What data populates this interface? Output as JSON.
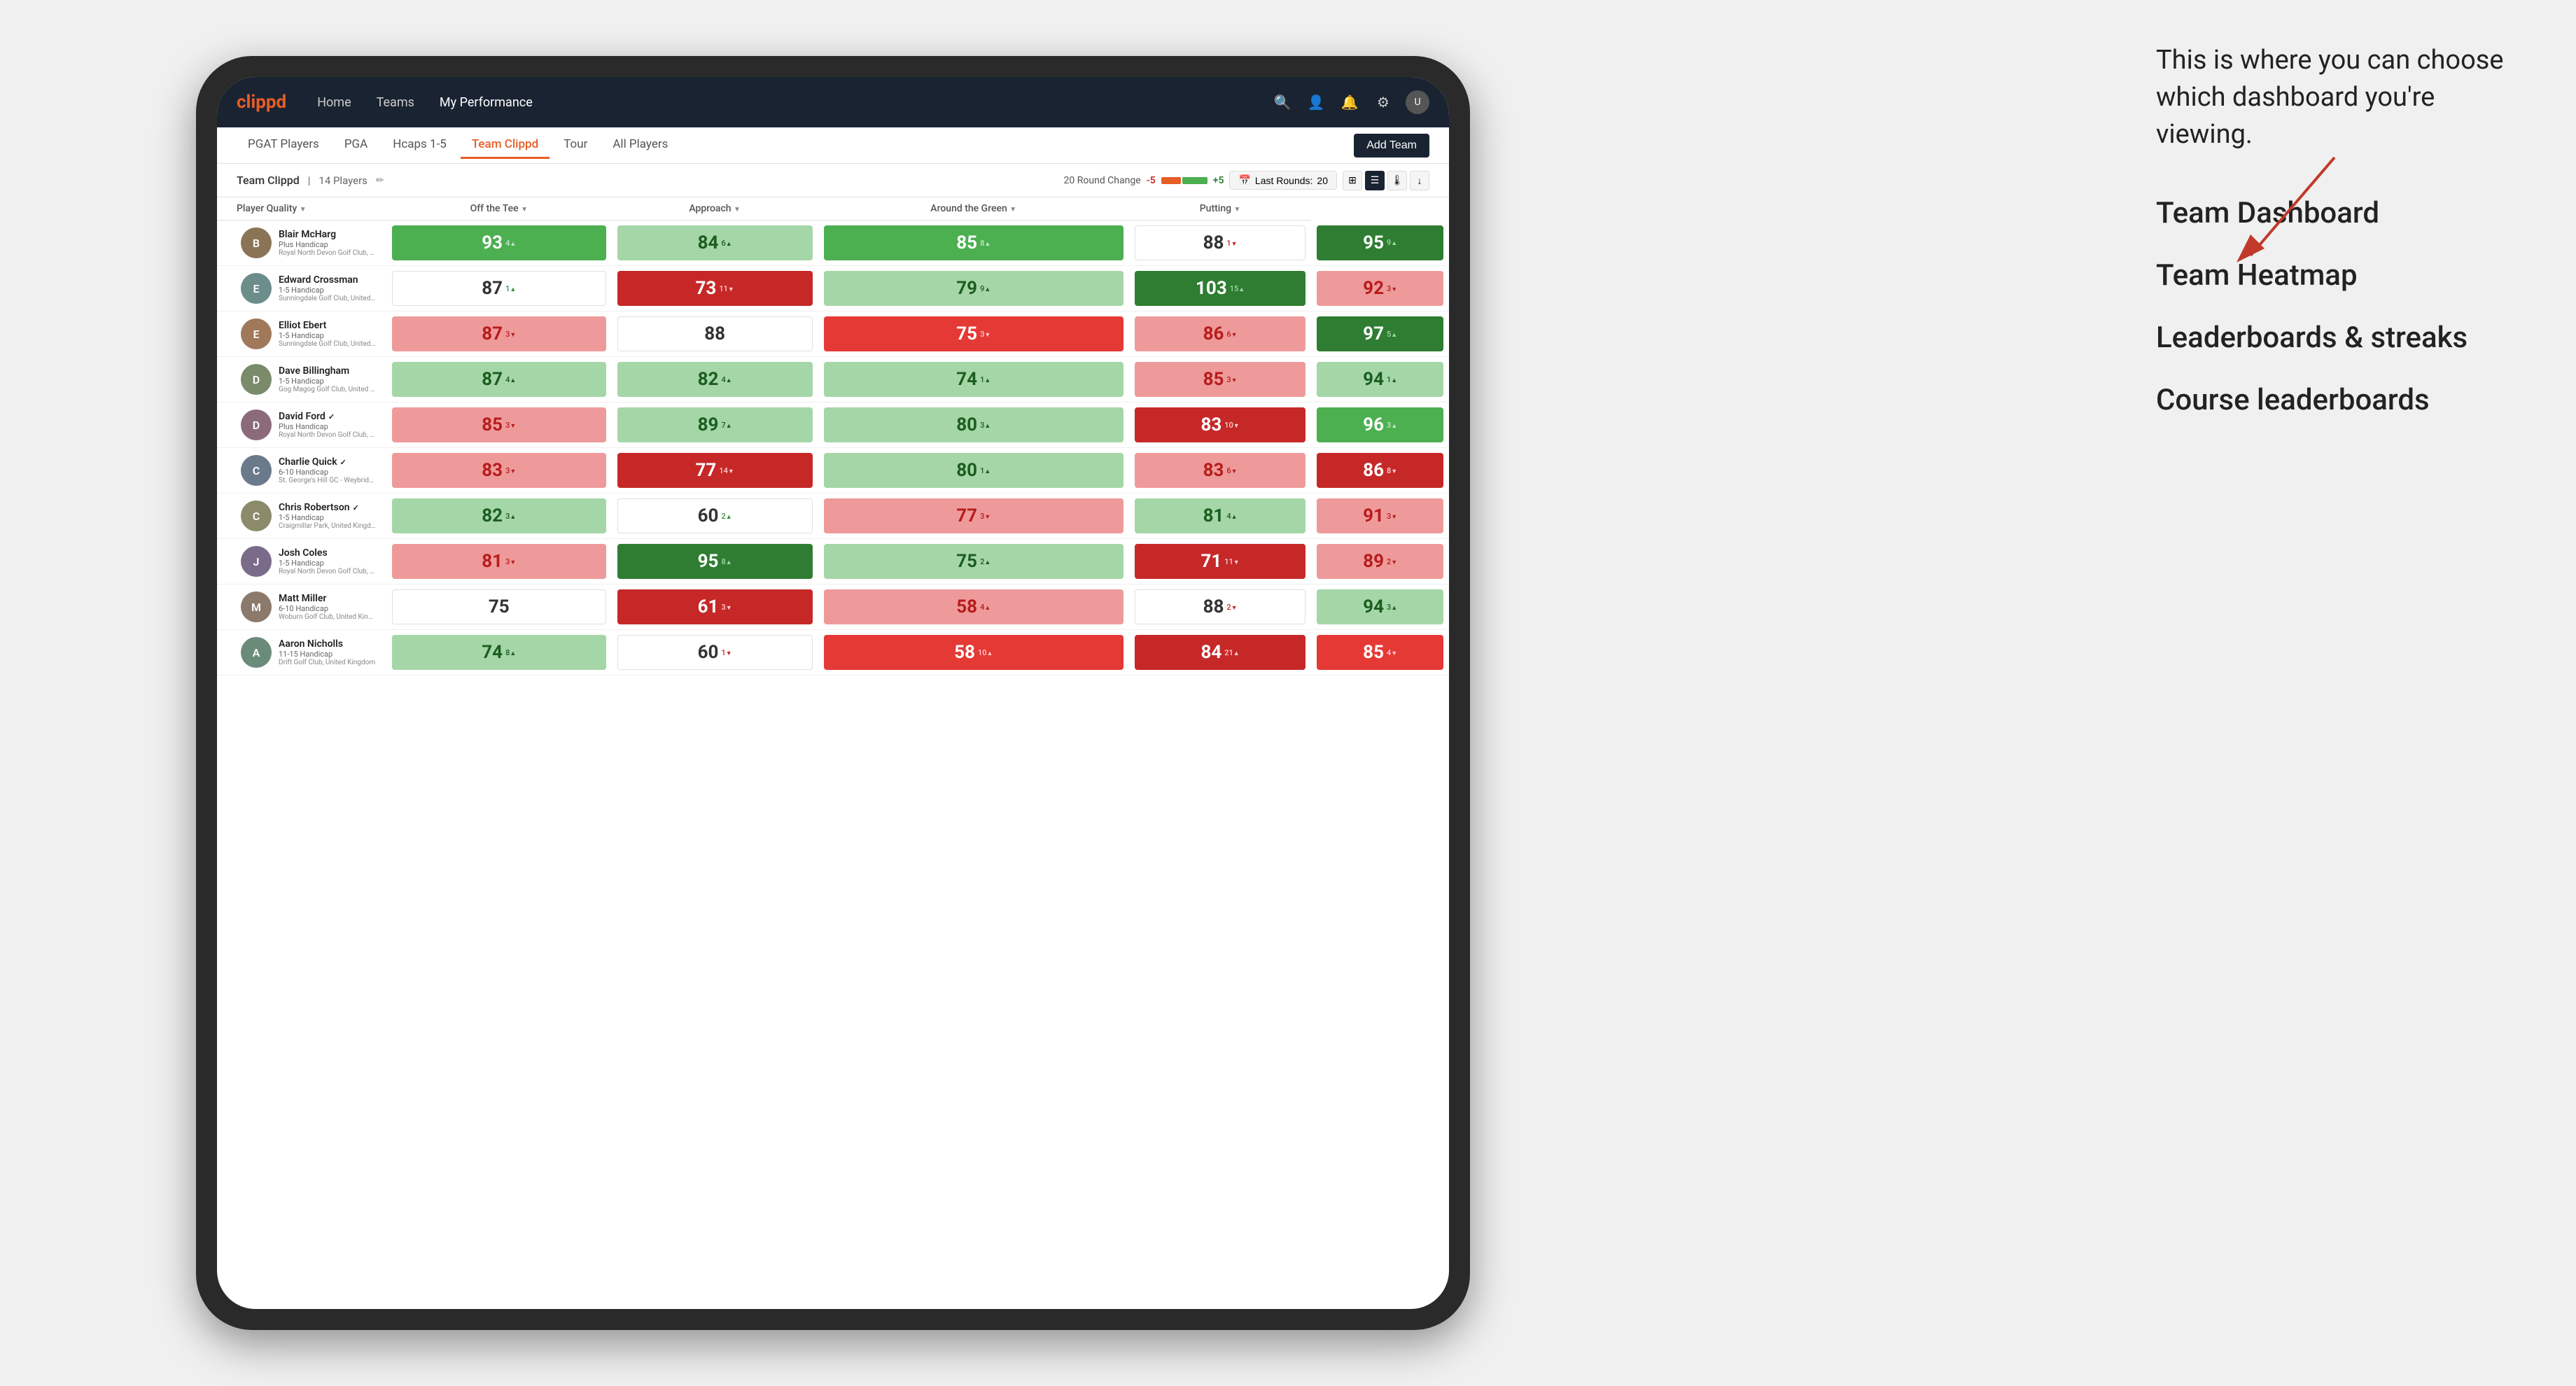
{
  "annotation": {
    "description": "This is where you can choose which dashboard you're viewing.",
    "menu_items": [
      "Team Dashboard",
      "Team Heatmap",
      "Leaderboards & streaks",
      "Course leaderboards"
    ]
  },
  "nav": {
    "logo": "clippd",
    "links": [
      "Home",
      "Teams",
      "My Performance"
    ],
    "active_link": "My Performance"
  },
  "sub_nav": {
    "links": [
      "PGAT Players",
      "PGA",
      "Hcaps 1-5",
      "Team Clippd",
      "Tour",
      "All Players"
    ],
    "active": "Team Clippd",
    "add_team": "Add Team"
  },
  "team_bar": {
    "team_name": "Team Clippd",
    "separator": "|",
    "player_count": "14 Players",
    "round_change_label": "20 Round Change",
    "round_change_neg": "-5",
    "round_change_pos": "+5",
    "last_rounds_label": "Last Rounds:",
    "last_rounds_value": "20"
  },
  "table": {
    "headers": [
      {
        "label": "Player Quality",
        "sort": true
      },
      {
        "label": "Off the Tee",
        "sort": true
      },
      {
        "label": "Approach",
        "sort": true
      },
      {
        "label": "Around the Green",
        "sort": true
      },
      {
        "label": "Putting",
        "sort": true
      }
    ],
    "players": [
      {
        "name": "Blair McHarg",
        "handicap": "Plus Handicap",
        "club": "Royal North Devon Golf Club, United Kingdom",
        "verified": false,
        "scores": [
          {
            "value": "93",
            "change": "4",
            "dir": "up",
            "color": "green-med"
          },
          {
            "value": "84",
            "change": "6",
            "dir": "up",
            "color": "green-light"
          },
          {
            "value": "85",
            "change": "8",
            "dir": "up",
            "color": "green-med"
          },
          {
            "value": "88",
            "change": "1",
            "dir": "down",
            "color": "white"
          },
          {
            "value": "95",
            "change": "9",
            "dir": "up",
            "color": "green-dark"
          }
        ]
      },
      {
        "name": "Edward Crossman",
        "handicap": "1-5 Handicap",
        "club": "Sunningdale Golf Club, United Kingdom",
        "verified": false,
        "scores": [
          {
            "value": "87",
            "change": "1",
            "dir": "up",
            "color": "white"
          },
          {
            "value": "73",
            "change": "11",
            "dir": "down",
            "color": "red-dark"
          },
          {
            "value": "79",
            "change": "9",
            "dir": "up",
            "color": "green-light"
          },
          {
            "value": "103",
            "change": "15",
            "dir": "up",
            "color": "green-dark"
          },
          {
            "value": "92",
            "change": "3",
            "dir": "down",
            "color": "red-light"
          }
        ]
      },
      {
        "name": "Elliot Ebert",
        "handicap": "1-5 Handicap",
        "club": "Sunningdale Golf Club, United Kingdom",
        "verified": false,
        "scores": [
          {
            "value": "87",
            "change": "3",
            "dir": "down",
            "color": "red-light"
          },
          {
            "value": "88",
            "change": "",
            "dir": "",
            "color": "white"
          },
          {
            "value": "75",
            "change": "3",
            "dir": "down",
            "color": "red-med"
          },
          {
            "value": "86",
            "change": "6",
            "dir": "down",
            "color": "red-light"
          },
          {
            "value": "97",
            "change": "5",
            "dir": "up",
            "color": "green-dark"
          }
        ]
      },
      {
        "name": "Dave Billingham",
        "handicap": "1-5 Handicap",
        "club": "Gog Magog Golf Club, United Kingdom",
        "verified": false,
        "scores": [
          {
            "value": "87",
            "change": "4",
            "dir": "up",
            "color": "green-light"
          },
          {
            "value": "82",
            "change": "4",
            "dir": "up",
            "color": "green-light"
          },
          {
            "value": "74",
            "change": "1",
            "dir": "up",
            "color": "green-light"
          },
          {
            "value": "85",
            "change": "3",
            "dir": "down",
            "color": "red-light"
          },
          {
            "value": "94",
            "change": "1",
            "dir": "up",
            "color": "green-light"
          }
        ]
      },
      {
        "name": "David Ford",
        "handicap": "Plus Handicap",
        "club": "Royal North Devon Golf Club, United Kingdom",
        "verified": true,
        "scores": [
          {
            "value": "85",
            "change": "3",
            "dir": "down",
            "color": "red-light"
          },
          {
            "value": "89",
            "change": "7",
            "dir": "up",
            "color": "green-light"
          },
          {
            "value": "80",
            "change": "3",
            "dir": "up",
            "color": "green-light"
          },
          {
            "value": "83",
            "change": "10",
            "dir": "down",
            "color": "red-dark"
          },
          {
            "value": "96",
            "change": "3",
            "dir": "up",
            "color": "green-med"
          }
        ]
      },
      {
        "name": "Charlie Quick",
        "handicap": "6-10 Handicap",
        "club": "St. George's Hill GC - Weybridge - Surrey, Uni...",
        "verified": true,
        "scores": [
          {
            "value": "83",
            "change": "3",
            "dir": "down",
            "color": "red-light"
          },
          {
            "value": "77",
            "change": "14",
            "dir": "down",
            "color": "red-dark"
          },
          {
            "value": "80",
            "change": "1",
            "dir": "up",
            "color": "green-light"
          },
          {
            "value": "83",
            "change": "6",
            "dir": "down",
            "color": "red-light"
          },
          {
            "value": "86",
            "change": "8",
            "dir": "down",
            "color": "red-dark"
          }
        ]
      },
      {
        "name": "Chris Robertson",
        "handicap": "1-5 Handicap",
        "club": "Craigmillar Park, United Kingdom",
        "verified": true,
        "scores": [
          {
            "value": "82",
            "change": "3",
            "dir": "up",
            "color": "green-light"
          },
          {
            "value": "60",
            "change": "2",
            "dir": "up",
            "color": "white"
          },
          {
            "value": "77",
            "change": "3",
            "dir": "down",
            "color": "red-light"
          },
          {
            "value": "81",
            "change": "4",
            "dir": "up",
            "color": "green-light"
          },
          {
            "value": "91",
            "change": "3",
            "dir": "down",
            "color": "red-light"
          }
        ]
      },
      {
        "name": "Josh Coles",
        "handicap": "1-5 Handicap",
        "club": "Royal North Devon Golf Club, United Kingdom",
        "verified": false,
        "scores": [
          {
            "value": "81",
            "change": "3",
            "dir": "down",
            "color": "red-light"
          },
          {
            "value": "95",
            "change": "8",
            "dir": "up",
            "color": "green-dark"
          },
          {
            "value": "75",
            "change": "2",
            "dir": "up",
            "color": "green-light"
          },
          {
            "value": "71",
            "change": "11",
            "dir": "down",
            "color": "red-dark"
          },
          {
            "value": "89",
            "change": "2",
            "dir": "down",
            "color": "red-light"
          }
        ]
      },
      {
        "name": "Matt Miller",
        "handicap": "6-10 Handicap",
        "club": "Woburn Golf Club, United Kingdom",
        "verified": false,
        "scores": [
          {
            "value": "75",
            "change": "",
            "dir": "",
            "color": "white"
          },
          {
            "value": "61",
            "change": "3",
            "dir": "down",
            "color": "red-dark"
          },
          {
            "value": "58",
            "change": "4",
            "dir": "up",
            "color": "red-light"
          },
          {
            "value": "88",
            "change": "2",
            "dir": "down",
            "color": "white"
          },
          {
            "value": "94",
            "change": "3",
            "dir": "up",
            "color": "green-light"
          }
        ]
      },
      {
        "name": "Aaron Nicholls",
        "handicap": "11-15 Handicap",
        "club": "Drift Golf Club, United Kingdom",
        "verified": false,
        "scores": [
          {
            "value": "74",
            "change": "8",
            "dir": "up",
            "color": "green-light"
          },
          {
            "value": "60",
            "change": "1",
            "dir": "down",
            "color": "white"
          },
          {
            "value": "58",
            "change": "10",
            "dir": "up",
            "color": "red-med"
          },
          {
            "value": "84",
            "change": "21",
            "dir": "up",
            "color": "red-dark"
          },
          {
            "value": "85",
            "change": "4",
            "dir": "down",
            "color": "red-med"
          }
        ]
      }
    ]
  }
}
